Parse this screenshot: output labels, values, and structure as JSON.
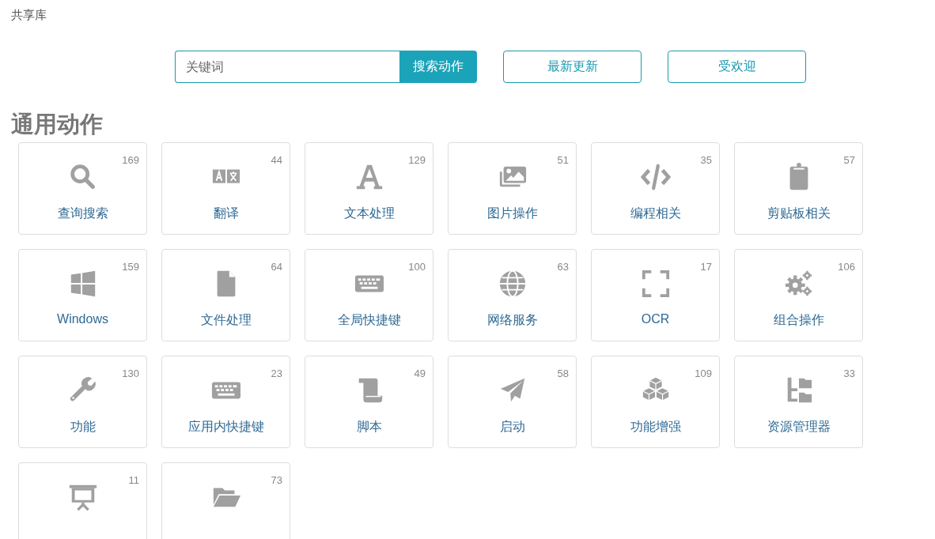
{
  "page_title": "共享库",
  "search": {
    "placeholder": "关键词",
    "button": "搜索动作"
  },
  "filter_buttons": [
    "最新更新",
    "受欢迎"
  ],
  "section_title": "通用动作",
  "categories": [
    {
      "label": "查询搜索",
      "count": "169"
    },
    {
      "label": "翻译",
      "count": "44"
    },
    {
      "label": "文本处理",
      "count": "129"
    },
    {
      "label": "图片操作",
      "count": "51"
    },
    {
      "label": "编程相关",
      "count": "35"
    },
    {
      "label": "剪贴板相关",
      "count": "57"
    },
    {
      "label": "Windows",
      "count": "159"
    },
    {
      "label": "文件处理",
      "count": "64"
    },
    {
      "label": "全局快捷键",
      "count": "100"
    },
    {
      "label": "网络服务",
      "count": "63"
    },
    {
      "label": "OCR",
      "count": "17"
    },
    {
      "label": "组合操作",
      "count": "106"
    },
    {
      "label": "功能",
      "count": "130"
    },
    {
      "label": "应用内快捷键",
      "count": "23"
    },
    {
      "label": "脚本",
      "count": "49"
    },
    {
      "label": "启动",
      "count": "58"
    },
    {
      "label": "功能增强",
      "count": "109"
    },
    {
      "label": "资源管理器",
      "count": "33"
    },
    {
      "count": "11"
    },
    {
      "count": "73"
    }
  ]
}
